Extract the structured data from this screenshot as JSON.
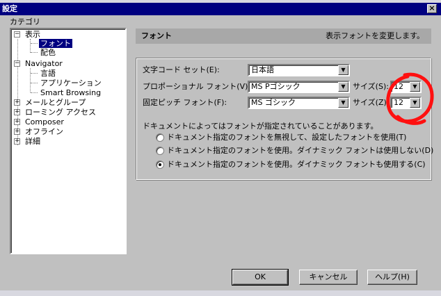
{
  "window": {
    "title": "設定",
    "close_glyph": "×"
  },
  "category_label": "カテゴリ",
  "tree": {
    "items": [
      {
        "label": "表示",
        "expander": "−"
      },
      {
        "label": "フォント"
      },
      {
        "label": "配色"
      },
      {
        "label": "Navigator",
        "expander": "−"
      },
      {
        "label": "言語"
      },
      {
        "label": "アプリケーション"
      },
      {
        "label": "Smart Browsing"
      },
      {
        "label": "メールとグループ",
        "expander": "+"
      },
      {
        "label": "ローミング アクセス",
        "expander": "+"
      },
      {
        "label": "Composer",
        "expander": "+"
      },
      {
        "label": "オフライン",
        "expander": "+"
      },
      {
        "label": "詳細",
        "expander": "+"
      }
    ],
    "selected": "フォント"
  },
  "panel": {
    "title": "フォント",
    "description": "表示フォントを変更します。"
  },
  "fields": {
    "charset_label": "文字コード セット(E):",
    "charset_value": "日本語",
    "proportional_label": "プロポーショナル フォント(V):",
    "proportional_value": "MS Pゴシック",
    "proportional_size_label": "サイズ(S):",
    "proportional_size_value": "12",
    "fixed_label": "固定ピッチ フォント(F):",
    "fixed_value": "MS ゴシック",
    "fixed_size_label": "サイズ(Z):",
    "fixed_size_value": "12",
    "dropdown_glyph": "▼"
  },
  "note": "ドキュメントによってはフォントが指定されていることがあります。",
  "radios": [
    {
      "label": "ドキュメント指定のフォントを無視して、設定したフォントを使用(T)",
      "checked": false
    },
    {
      "label": "ドキュメント指定のフォントを使用。ダイナミック フォントは使用しない(D)",
      "checked": false
    },
    {
      "label": "ドキュメント指定のフォントを使用。ダイナミック フォントも使用する(C)",
      "checked": true
    }
  ],
  "buttons": {
    "ok": "OK",
    "cancel": "キャンセル",
    "help": "ヘルプ(H)"
  },
  "colors": {
    "titlebar": "#000080",
    "selection": "#000080",
    "annotation": "#ff1010"
  }
}
